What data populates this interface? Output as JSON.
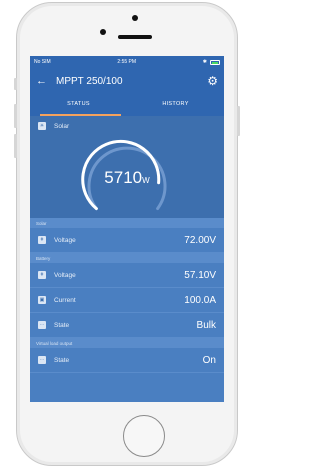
{
  "status_bar": {
    "carrier": "No SIM",
    "time": "2:55 PM",
    "bluetooth": "✱"
  },
  "app_bar": {
    "back_icon": "back-arrow-icon",
    "title": "MPPT 250/100",
    "settings_icon": "gear-icon"
  },
  "tabs": [
    {
      "label": "STATUS",
      "active": true
    },
    {
      "label": "HISTORY",
      "active": false
    }
  ],
  "solar": {
    "label": "Solar",
    "power_value": "5710",
    "power_unit": "W"
  },
  "sections": {
    "solar_label": "Solar",
    "battery_label": "Battery",
    "load_label": "Virtual load output"
  },
  "rows": {
    "solar_voltage": {
      "label": "Voltage",
      "value": "72.00V"
    },
    "battery_voltage": {
      "label": "Voltage",
      "value": "57.10V"
    },
    "battery_current": {
      "label": "Current",
      "value": "100.0A"
    },
    "battery_state": {
      "label": "State",
      "value": "Bulk"
    },
    "load_state": {
      "label": "State",
      "value": "On"
    }
  },
  "colors": {
    "primary": "#2f66b0",
    "accent": "#f5a25d",
    "background": "#4a7fc1"
  }
}
